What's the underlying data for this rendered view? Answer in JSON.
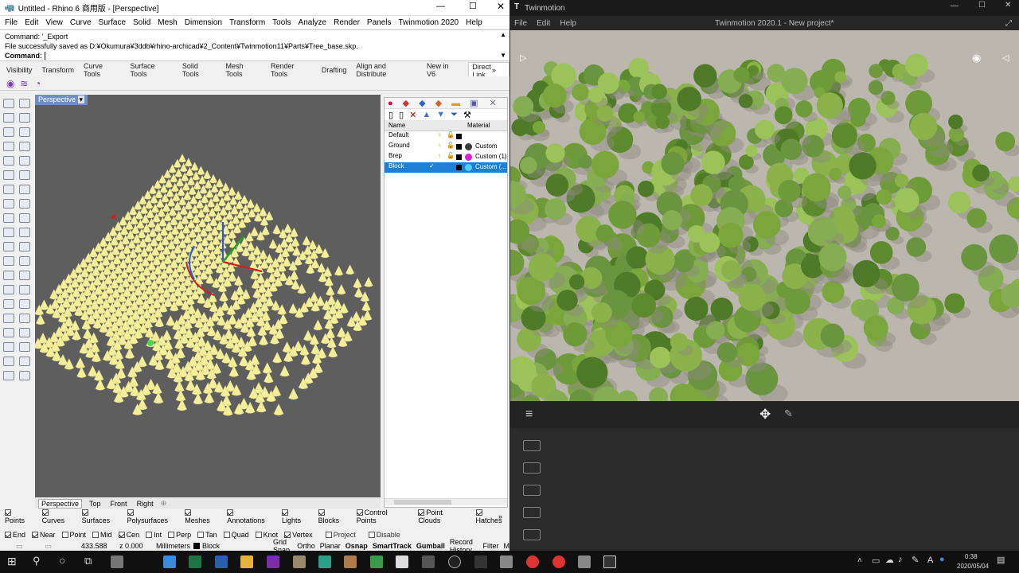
{
  "rhino": {
    "title": "Untitled - Rhino 6 商用版 - [Perspective]",
    "menu": [
      "File",
      "Edit",
      "View",
      "Curve",
      "Surface",
      "Solid",
      "Mesh",
      "Dimension",
      "Transform",
      "Tools",
      "Analyze",
      "Render",
      "Panels",
      "Twinmotion 2020",
      "Help"
    ],
    "command_history": [
      "Command: '_Export",
      "File successfully saved as D:¥Okumura¥3ddb¥rhino-archicad¥2_Content¥Twinmotion11¥Parts¥Tree_base.skp."
    ],
    "command_prompt": "Command:",
    "toolbar_tabs": [
      "Visibility",
      "Transform",
      "Curve Tools",
      "Surface Tools",
      "Solid Tools",
      "Mesh Tools",
      "Render Tools",
      "Drafting",
      "Align and Distribute",
      "New in V6",
      "Direct Link"
    ],
    "active_tab": "Direct Link",
    "viewport_label": "Perspective",
    "viewport_tabs": [
      "Perspective",
      "Top",
      "Front",
      "Right"
    ],
    "layers": {
      "columns": [
        "Name",
        "Material"
      ],
      "rows": [
        {
          "name": "Default",
          "material": "",
          "matcolor": "#ffffff"
        },
        {
          "name": "Ground",
          "material": "Custom",
          "matcolor": "#3a3a3a"
        },
        {
          "name": "Brep",
          "material": "Custom (1)",
          "matcolor": "#d61fd6"
        },
        {
          "name": "Block",
          "material": "Custom (...",
          "matcolor": "#4fd0e8"
        }
      ],
      "selected": "Block"
    },
    "filters": [
      "Points",
      "Curves",
      "Surfaces",
      "Polysurfaces",
      "Meshes",
      "Annotations",
      "Lights",
      "Blocks",
      "Control Points",
      "Point Clouds",
      "Hatches"
    ],
    "osnaps": [
      {
        "label": "End",
        "on": true
      },
      {
        "label": "Near",
        "on": true
      },
      {
        "label": "Point",
        "on": false
      },
      {
        "label": "Mid",
        "on": false
      },
      {
        "label": "Cen",
        "on": true
      },
      {
        "label": "Int",
        "on": false
      },
      {
        "label": "Perp",
        "on": false
      },
      {
        "label": "Tan",
        "on": false
      },
      {
        "label": "Quad",
        "on": false
      },
      {
        "label": "Knot",
        "on": false
      },
      {
        "label": "Vertex",
        "on": true
      },
      {
        "label": "Project",
        "on": false
      },
      {
        "label": "Disable",
        "on": false
      }
    ],
    "status": {
      "coord": "433.588",
      "z": "z 0.000",
      "units": "Millimeters",
      "layer": "Block",
      "toggles": [
        "Grid Snap",
        "Ortho",
        "Planar",
        "Osnap",
        "SmartTrack",
        "Gumball",
        "Record History",
        "Filter",
        "M"
      ]
    }
  },
  "twinmotion": {
    "app_name": "Twinmotion",
    "menu": [
      "File",
      "Edit",
      "Help"
    ],
    "project_title": "Twinmotion 2020.1 - New project*"
  },
  "taskbar": {
    "time": "0:38",
    "date": "2020/05/04",
    "ime": "A"
  },
  "colors": {
    "rhino_viewport": "#5e5e5e",
    "cone_yellow": "#f2ee9a",
    "layer_selected": "#1e7fd6",
    "tm_ground": "#bcb7ae",
    "tree_green": "#6f9a3a"
  }
}
